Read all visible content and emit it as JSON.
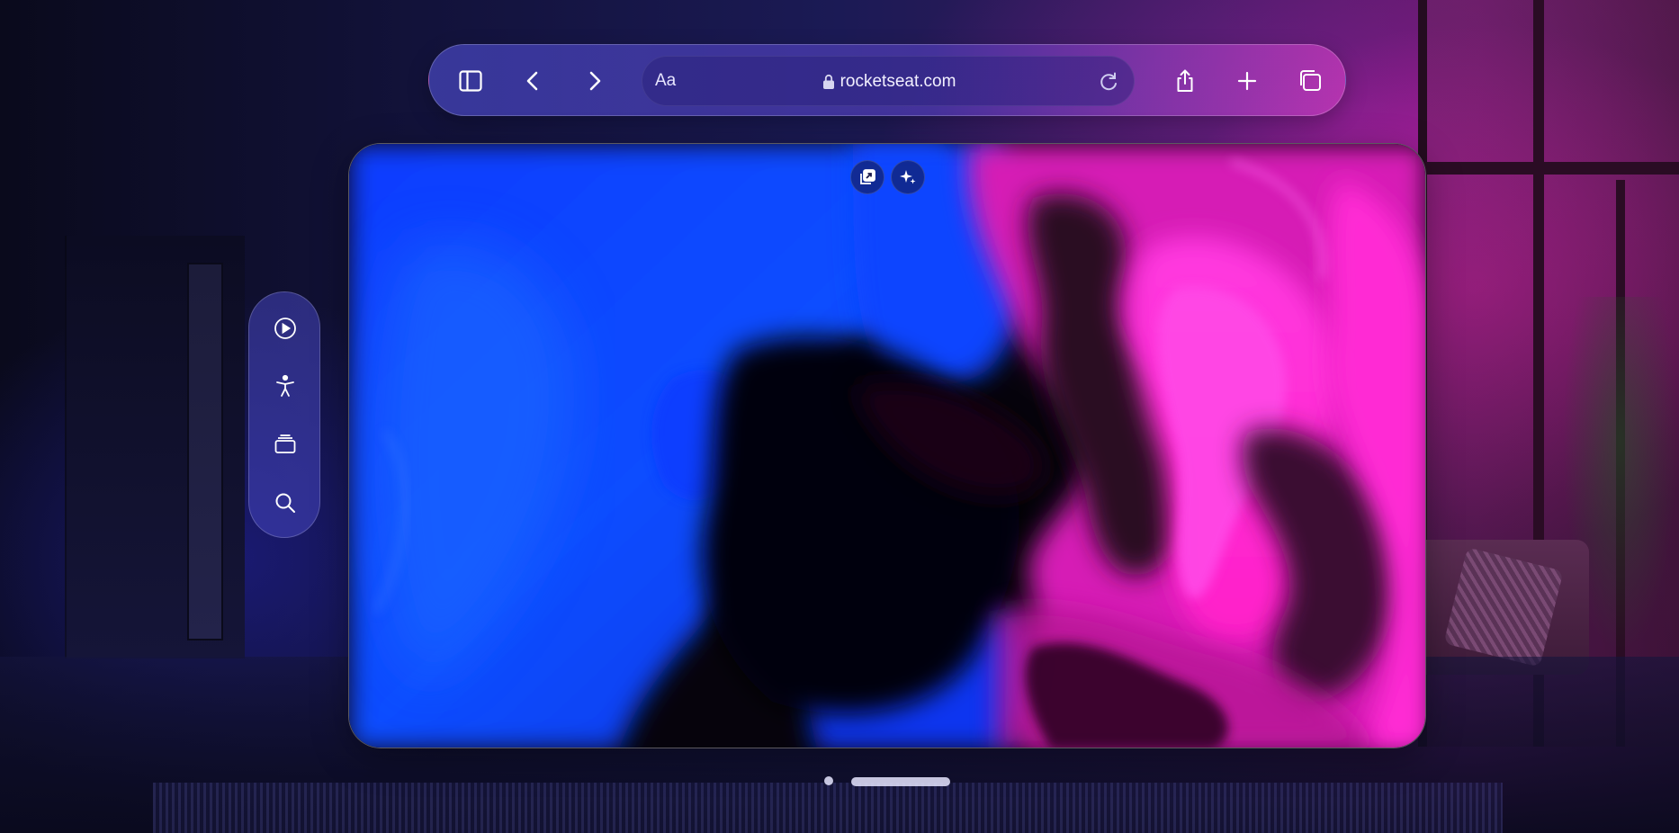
{
  "toolbar": {
    "address_prefix": "Aa",
    "url": "rocketseat.com",
    "buttons": {
      "sidebar": "sidebar-icon",
      "back": "chevron-left-icon",
      "forward": "chevron-right-icon",
      "reload": "reload-icon",
      "share": "share-icon",
      "new_tab": "plus-icon",
      "tabs": "tab-overview-icon"
    }
  },
  "content": {
    "floating_buttons": [
      "picture-in-picture-icon",
      "sparkles-icon"
    ]
  },
  "side_ornament": {
    "buttons": [
      "play-circle-icon",
      "accessibility-icon",
      "stack-icon",
      "search-icon"
    ]
  },
  "colors": {
    "blue": "#0a3cff",
    "magenta": "#ff2ad4",
    "toolbar_tint": "#4646be"
  }
}
